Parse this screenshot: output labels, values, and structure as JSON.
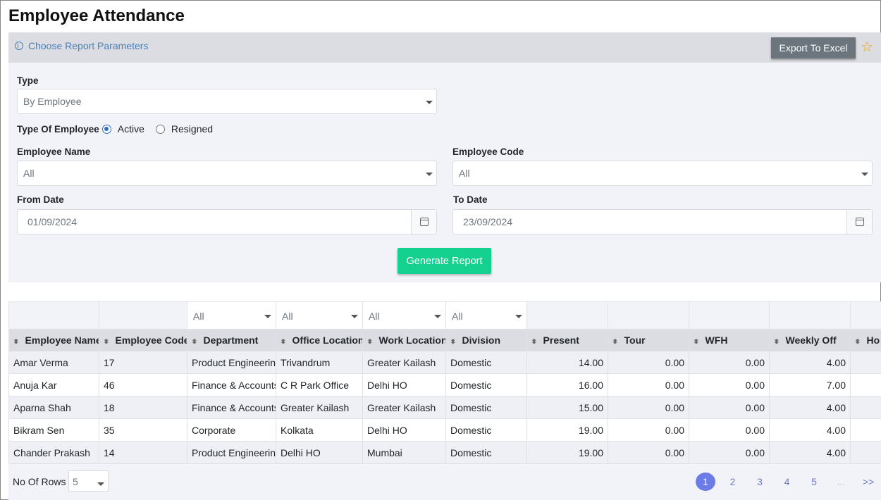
{
  "page": {
    "title": "Employee Attendance"
  },
  "params": {
    "link_label": "Choose Report Parameters",
    "export_label": "Export To Excel",
    "type_label": "Type",
    "type_value": "By Employee",
    "employee_type_label": "Type Of Employee",
    "radio_active_label": "Active",
    "radio_resigned_label": "Resigned",
    "selected_employee_type": "Active",
    "employee_name_label": "Employee Name",
    "employee_name_value": "All",
    "employee_code_label": "Employee Code",
    "employee_code_value": "All",
    "from_date_label": "From Date",
    "from_date_value": "01/09/2024",
    "to_date_label": "To Date",
    "to_date_value": "23/09/2024",
    "generate_label": "Generate Report"
  },
  "table": {
    "filters": [
      "",
      "",
      "All",
      "All",
      "All",
      "All",
      "",
      "",
      "",
      "",
      ""
    ],
    "columns": [
      "Employee Name",
      "Employee Code",
      "Department",
      "Office Location",
      "Work Location",
      "Division",
      "Present",
      "Tour",
      "WFH",
      "Weekly Off",
      "Ho"
    ],
    "rows": [
      [
        "Amar Verma",
        "17",
        "Product Engineering",
        "Trivandrum",
        "Greater Kailash",
        "Domestic",
        "14.00",
        "0.00",
        "0.00",
        "4.00",
        ""
      ],
      [
        "Anuja Kar",
        "46",
        "Finance & Accounts",
        "C R Park Office",
        "Delhi HO",
        "Domestic",
        "16.00",
        "0.00",
        "0.00",
        "7.00",
        ""
      ],
      [
        "Aparna Shah",
        "18",
        "Finance & Accounts",
        "Greater Kailash",
        "Greater Kailash",
        "Domestic",
        "15.00",
        "0.00",
        "0.00",
        "4.00",
        ""
      ],
      [
        "Bikram Sen",
        "35",
        "Corporate",
        "Kolkata",
        "Delhi HO",
        "Domestic",
        "19.00",
        "0.00",
        "0.00",
        "4.00",
        ""
      ],
      [
        "Chander Prakash",
        "14",
        "Product Engineering",
        "Delhi HO",
        "Mumbai",
        "Domestic",
        "19.00",
        "0.00",
        "0.00",
        "4.00",
        ""
      ]
    ]
  },
  "footer": {
    "rows_label": "No Of Rows :",
    "rows_value": "5",
    "pages": [
      "1",
      "2",
      "3",
      "4",
      "5",
      "...",
      ">>"
    ],
    "current_page": "1"
  },
  "colors": {
    "accent_green": "#15d18f",
    "export_grey": "#6c757d",
    "pager_blue": "#6b7ce8",
    "star": "#f0a30a"
  }
}
